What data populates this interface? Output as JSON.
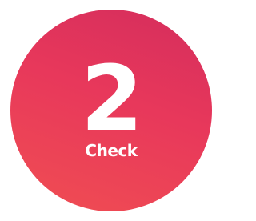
{
  "badge": {
    "number": "2",
    "label": "Check"
  },
  "colors": {
    "gradient_top": "#d42d5c",
    "gradient_mid": "#e8385b",
    "gradient_bottom": "#f04e52",
    "text": "#ffffff",
    "background": "#ffffff"
  }
}
